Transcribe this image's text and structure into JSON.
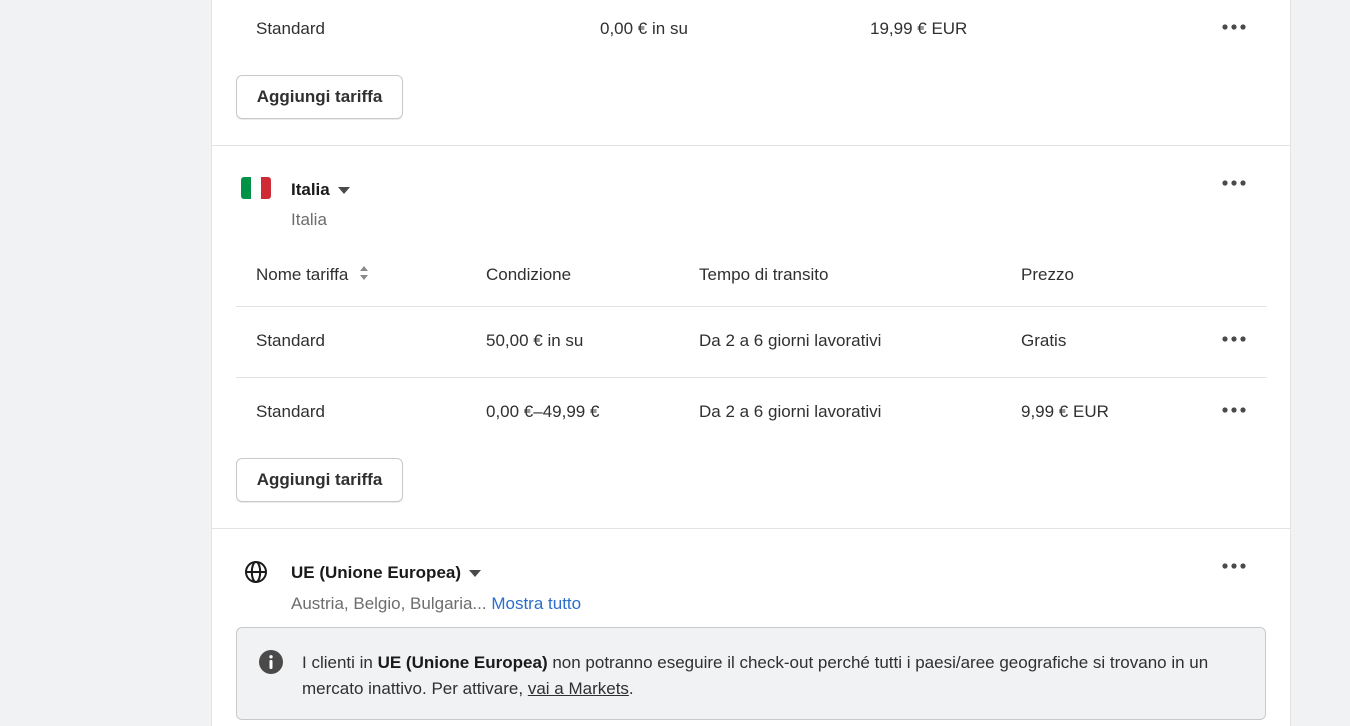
{
  "top_section": {
    "row": {
      "name": "Standard",
      "condition": "0,00 € in su",
      "price": "19,99 € EUR",
      "menu_icon": "more-horizontal-icon"
    },
    "add_rate_label": "Aggiungi tariffa"
  },
  "italia_zone": {
    "flag_colors": [
      "#009246",
      "#ffffff",
      "#ce2b37"
    ],
    "title": "Italia",
    "subtitle": "Italia",
    "columns": {
      "name": "Nome tariffa",
      "condition": "Condizione",
      "transit": "Tempo di transito",
      "price": "Prezzo"
    },
    "rows": [
      {
        "name": "Standard",
        "condition": "50,00 € in su",
        "transit": "Da 2 a 6 giorni lavorativi",
        "price": "Gratis"
      },
      {
        "name": "Standard",
        "condition": "0,00 €–49,99 €",
        "transit": "Da 2 a 6 giorni lavorativi",
        "price": "9,99 € EUR"
      }
    ],
    "add_rate_label": "Aggiungi tariffa"
  },
  "eu_zone": {
    "icon": "globe-icon",
    "title": "UE (Unione Europea)",
    "countries": "Austria, Belgio, Bulgaria...",
    "show_all": "Mostra tutto",
    "banner": {
      "icon": "info-icon",
      "text_before": "I clienti in ",
      "bold": "UE (Unione Europea)",
      "text_middle": " non potranno eseguire il check-out perché tutti i paesi/aree geografiche si trovano in un mercato inattivo. Per attivare, ",
      "link": "vai a Markets",
      "text_after": "."
    }
  },
  "colors": {
    "page_background": "#f1f2f4",
    "card_background": "#ffffff",
    "link": "#2c6ecb",
    "divider": "#e3e3e3"
  }
}
